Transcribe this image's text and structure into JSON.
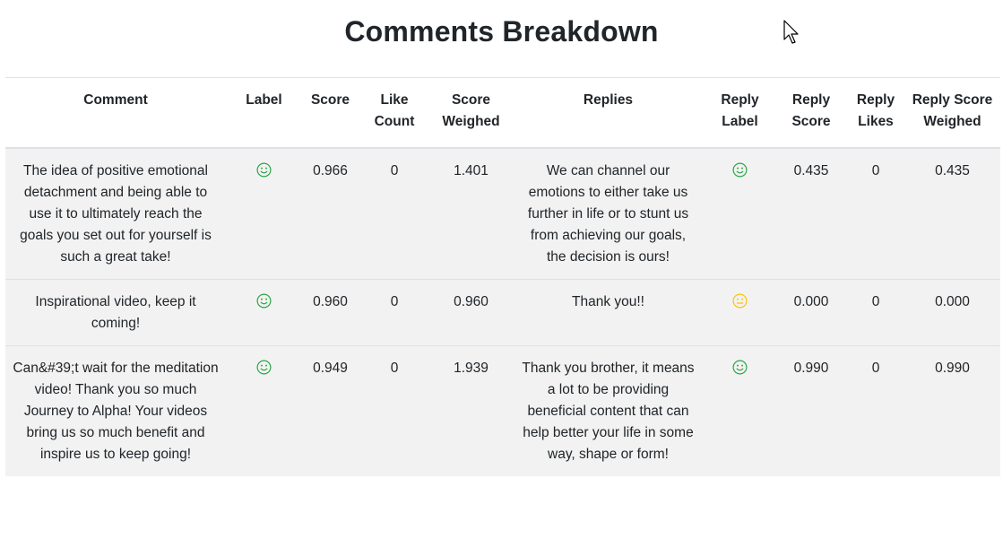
{
  "page": {
    "title": "Comments Breakdown"
  },
  "colors": {
    "positive": "#28a745",
    "neutral": "#ffc107",
    "stripe": "#f2f2f2",
    "border": "#dee2e6"
  },
  "table": {
    "headers": [
      "Comment",
      "Label",
      "Score",
      "Like Count",
      "Score Weighed",
      "Replies",
      "Reply Label",
      "Reply Score",
      "Reply Likes",
      "Reply Score Weighed"
    ],
    "rows": [
      {
        "comment": "The idea of positive emotional detachment and being able to use it to ultimately reach the goals you set out for yourself is such a great take!",
        "label": "smile-positive-icon",
        "score": "0.966",
        "like_count": "0",
        "score_weighed": "1.401",
        "reply": "We can channel our emotions to either take us further in life or to stunt us from achieving our goals, the decision is ours!",
        "reply_label": "smile-positive-icon",
        "reply_score": "0.435",
        "reply_likes": "0",
        "reply_score_weighed": "0.435"
      },
      {
        "comment": "Inspirational video, keep it coming!",
        "label": "smile-positive-icon",
        "score": "0.960",
        "like_count": "0",
        "score_weighed": "0.960",
        "reply": "Thank you!!",
        "reply_label": "neutral-face-icon",
        "reply_score": "0.000",
        "reply_likes": "0",
        "reply_score_weighed": "0.000"
      },
      {
        "comment": "Can&#39;t wait for the meditation video! Thank you so much Journey to Alpha! Your videos bring us so much benefit and inspire us to keep going!",
        "label": "smile-positive-icon",
        "score": "0.949",
        "like_count": "0",
        "score_weighed": "1.939",
        "reply": "Thank you brother, it means a lot to be providing beneficial content that can help better your life in some way, shape or form!",
        "reply_label": "smile-positive-icon",
        "reply_score": "0.990",
        "reply_likes": "0",
        "reply_score_weighed": "0.990"
      }
    ]
  }
}
